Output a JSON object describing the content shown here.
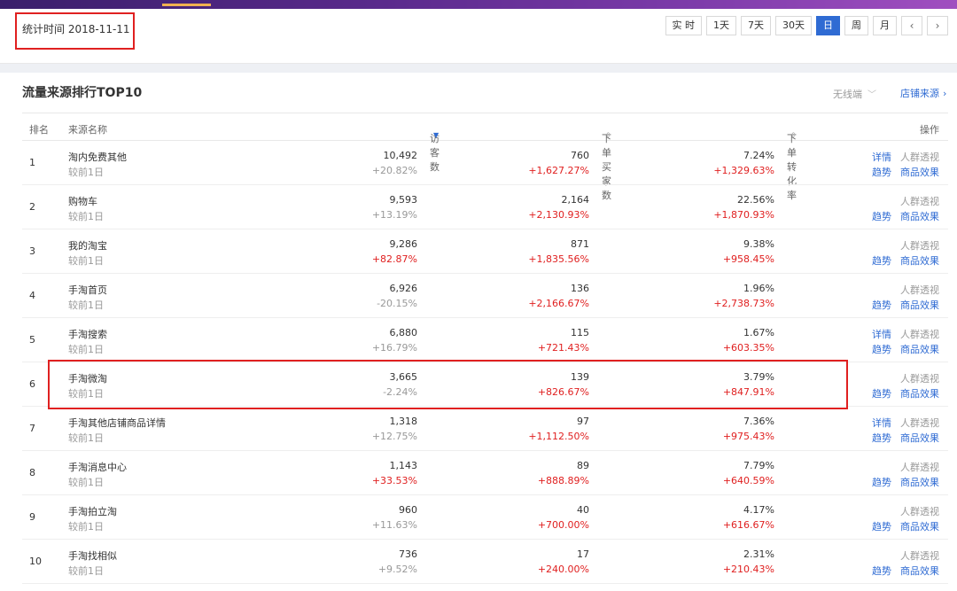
{
  "date_bar": {
    "label": "统计时间 2018-11-11",
    "tabs": [
      {
        "label": "实 时",
        "active": false
      },
      {
        "label": "1天",
        "active": false
      },
      {
        "label": "7天",
        "active": false
      },
      {
        "label": "30天",
        "active": false
      },
      {
        "label": "日",
        "active": true
      },
      {
        "label": "周",
        "active": false
      },
      {
        "label": "月",
        "active": false
      }
    ],
    "prev": "‹",
    "next": "›"
  },
  "panel": {
    "title": "流量来源排行TOP10",
    "device": "无线端",
    "shop_source": "店铺来源",
    "columns": {
      "rank": "排名",
      "name": "来源名称",
      "visitors": "访客数",
      "buyers": "下单买家数",
      "conversion": "下单转化率",
      "ops": "操作"
    },
    "compare_label": "较前1日",
    "op_labels": {
      "detail": "详情",
      "crowd": "人群透视",
      "trend": "趋势",
      "product": "商品效果"
    },
    "rows": [
      {
        "rank": "1",
        "name": "淘内免费其他",
        "visitors": "10,492",
        "visitors_chg": "+20.82%",
        "visitors_red": false,
        "buyers": "760",
        "buyers_chg": "+1,627.27%",
        "conv": "7.24%",
        "conv_chg": "+1,329.63%",
        "detail": true
      },
      {
        "rank": "2",
        "name": "购物车",
        "visitors": "9,593",
        "visitors_chg": "+13.19%",
        "visitors_red": false,
        "buyers": "2,164",
        "buyers_chg": "+2,130.93%",
        "conv": "22.56%",
        "conv_chg": "+1,870.93%",
        "detail": false
      },
      {
        "rank": "3",
        "name": "我的淘宝",
        "visitors": "9,286",
        "visitors_chg": "+82.87%",
        "visitors_red": true,
        "buyers": "871",
        "buyers_chg": "+1,835.56%",
        "conv": "9.38%",
        "conv_chg": "+958.45%",
        "detail": false
      },
      {
        "rank": "4",
        "name": "手淘首页",
        "visitors": "6,926",
        "visitors_chg": "-20.15%",
        "visitors_red": false,
        "buyers": "136",
        "buyers_chg": "+2,166.67%",
        "conv": "1.96%",
        "conv_chg": "+2,738.73%",
        "detail": false
      },
      {
        "rank": "5",
        "name": "手淘搜索",
        "visitors": "6,880",
        "visitors_chg": "+16.79%",
        "visitors_red": false,
        "buyers": "115",
        "buyers_chg": "+721.43%",
        "conv": "1.67%",
        "conv_chg": "+603.35%",
        "detail": true
      },
      {
        "rank": "6",
        "name": "手淘微淘",
        "visitors": "3,665",
        "visitors_chg": "-2.24%",
        "visitors_red": false,
        "buyers": "139",
        "buyers_chg": "+826.67%",
        "conv": "3.79%",
        "conv_chg": "+847.91%",
        "detail": false
      },
      {
        "rank": "7",
        "name": "手淘其他店铺商品详情",
        "visitors": "1,318",
        "visitors_chg": "+12.75%",
        "visitors_red": false,
        "buyers": "97",
        "buyers_chg": "+1,112.50%",
        "conv": "7.36%",
        "conv_chg": "+975.43%",
        "detail": true
      },
      {
        "rank": "8",
        "name": "手淘消息中心",
        "visitors": "1,143",
        "visitors_chg": "+33.53%",
        "visitors_red": true,
        "buyers": "89",
        "buyers_chg": "+888.89%",
        "conv": "7.79%",
        "conv_chg": "+640.59%",
        "detail": false
      },
      {
        "rank": "9",
        "name": "手淘拍立淘",
        "visitors": "960",
        "visitors_chg": "+11.63%",
        "visitors_red": false,
        "buyers": "40",
        "buyers_chg": "+700.00%",
        "conv": "4.17%",
        "conv_chg": "+616.67%",
        "detail": false
      },
      {
        "rank": "10",
        "name": "手淘找相似",
        "visitors": "736",
        "visitors_chg": "+9.52%",
        "visitors_red": false,
        "buyers": "17",
        "buyers_chg": "+240.00%",
        "conv": "2.31%",
        "conv_chg": "+210.43%",
        "detail": false
      }
    ]
  },
  "colors": {
    "accent": "#2f6bd3",
    "up": "#e02020",
    "annotation": "#e02020"
  }
}
